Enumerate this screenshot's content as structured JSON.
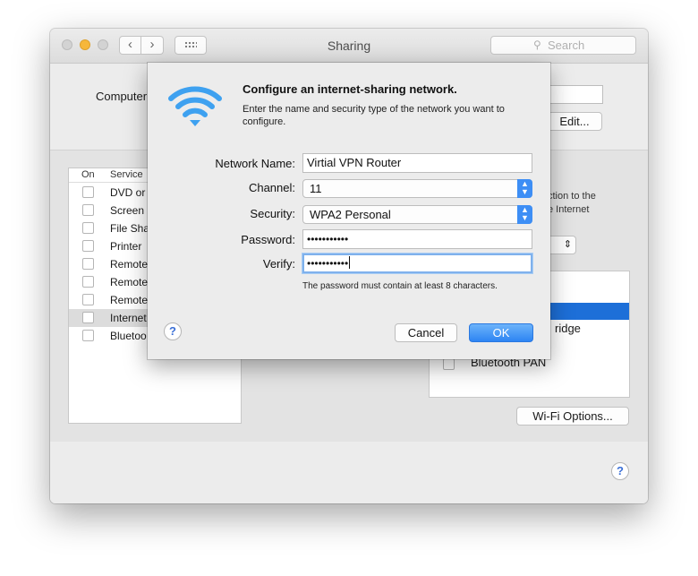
{
  "window": {
    "title": "Sharing",
    "search_placeholder": "Search"
  },
  "background": {
    "computer_name_label": "Computer",
    "edit_button": "Edit...",
    "services_header": {
      "on": "On",
      "service": "Service"
    },
    "services": [
      {
        "label": "DVD or",
        "checked": false
      },
      {
        "label": "Screen",
        "checked": false
      },
      {
        "label": "File Sha",
        "checked": false
      },
      {
        "label": "Printer",
        "checked": false
      },
      {
        "label": "Remote",
        "checked": false
      },
      {
        "label": "Remote",
        "checked": false
      },
      {
        "label": "Remote",
        "checked": false
      },
      {
        "label": "Internet",
        "checked": false,
        "selected": true
      },
      {
        "label": "Bluetoo",
        "checked": false
      }
    ],
    "right_text_1": "ction to the",
    "right_text_2": "e Internet",
    "right_list": {
      "item_bridge": "ridge",
      "item_bluetooth": "Bluetooth PAN"
    },
    "wifi_options_button": "Wi-Fi Options..."
  },
  "sheet": {
    "title": "Configure an internet-sharing network.",
    "description": "Enter the name and security type of the network you want to configure.",
    "network_name_label": "Network Name:",
    "network_name_value": "Virtial VPN Router",
    "channel_label": "Channel:",
    "channel_value": "11",
    "security_label": "Security:",
    "security_value": "WPA2 Personal",
    "password_label": "Password:",
    "password_value": "•••••••••••",
    "verify_label": "Verify:",
    "verify_value": "•••••••••••",
    "hint": "The password must contain at least 8 characters.",
    "cancel_button": "Cancel",
    "ok_button": "OK",
    "help_glyph": "?"
  },
  "colors": {
    "accent": "#2d84f3",
    "wifi_icon": "#3ea1f0",
    "minimize": "#f6b73b",
    "selection_blue": "#1d6fd8"
  }
}
